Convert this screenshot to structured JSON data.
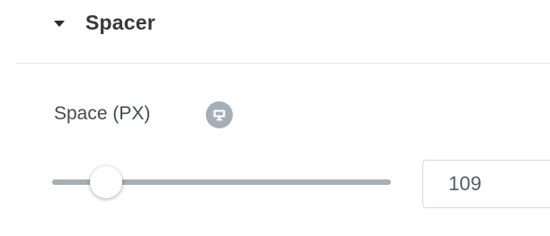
{
  "section": {
    "title": "Spacer",
    "caret_icon": "caret-down-icon",
    "expanded": true
  },
  "space_control": {
    "label": "Space (PX)",
    "responsive_icon": "desktop-icon",
    "value": "109",
    "slider_fraction": 0.16
  },
  "colors": {
    "track": "#a4afb7",
    "title": "#383838",
    "label": "#444b52",
    "input_border": "#d5dadf"
  }
}
